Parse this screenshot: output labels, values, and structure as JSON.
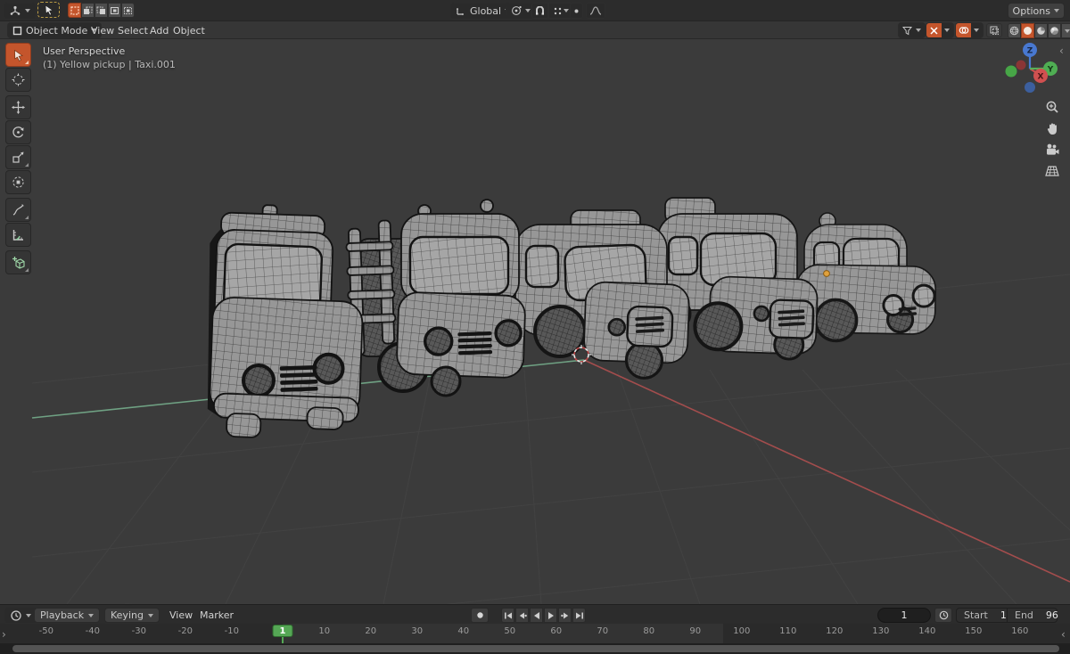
{
  "topbar": {
    "editor_type": "3D Viewport",
    "active_tool": "Select Box",
    "select_modes": [
      "New",
      "Extend",
      "Subtract",
      "Invert",
      "Intersect"
    ],
    "orientation_value": "Global",
    "options_label": "Options"
  },
  "viewport_header": {
    "mode": "Object Mode",
    "menus": [
      "View",
      "Select",
      "Add",
      "Object"
    ],
    "shading_active": "Solid"
  },
  "viewport": {
    "overlay_line1": "User Perspective",
    "overlay_line2": "(1) Yellow pickup | Taxi.001",
    "gizmo": {
      "x": "X",
      "y": "Y",
      "z": "Z"
    }
  },
  "timeline": {
    "playback_label": "Playback",
    "keying_label": "Keying",
    "view_label": "View",
    "marker_label": "Marker",
    "current_frame": "1",
    "start_label": "Start",
    "start_value": "1",
    "end_label": "End",
    "end_value": "96",
    "ticks": [
      -50,
      -40,
      -30,
      -20,
      -10,
      10,
      20,
      30,
      40,
      50,
      60,
      70,
      80,
      90,
      100,
      110,
      120,
      130,
      140,
      150,
      160
    ]
  },
  "icons": {
    "editor-type-icon": "3d-viewport-glyph",
    "timeline-editor-icon": "clock",
    "snap-magnet-icon": "magnet",
    "proportional-editing-icon": "dot-circle",
    "falloff-curve-icon": "bell-curve",
    "gizmo-toggle-icon": "crossing-arrows",
    "overlays-toggle-icon": "overlapping-circles",
    "xray-toggle-icon": "nested-squares",
    "shading-icons": [
      "wireframe-sphere",
      "solid-sphere",
      "material-sphere",
      "rendered-sphere"
    ],
    "nav-icons": [
      "zoom-magnifier",
      "pan-hand",
      "camera-view",
      "toggle-ortho-grid"
    ]
  },
  "colors": {
    "accent_orange": "#c4552c",
    "frame_marker_green": "#55a755",
    "axis_x_red": "#a34d4d",
    "axis_y_green": "#6fa183",
    "gizmo_x": "#d05050",
    "gizmo_y": "#58b058",
    "gizmo_z": "#4878d0"
  }
}
